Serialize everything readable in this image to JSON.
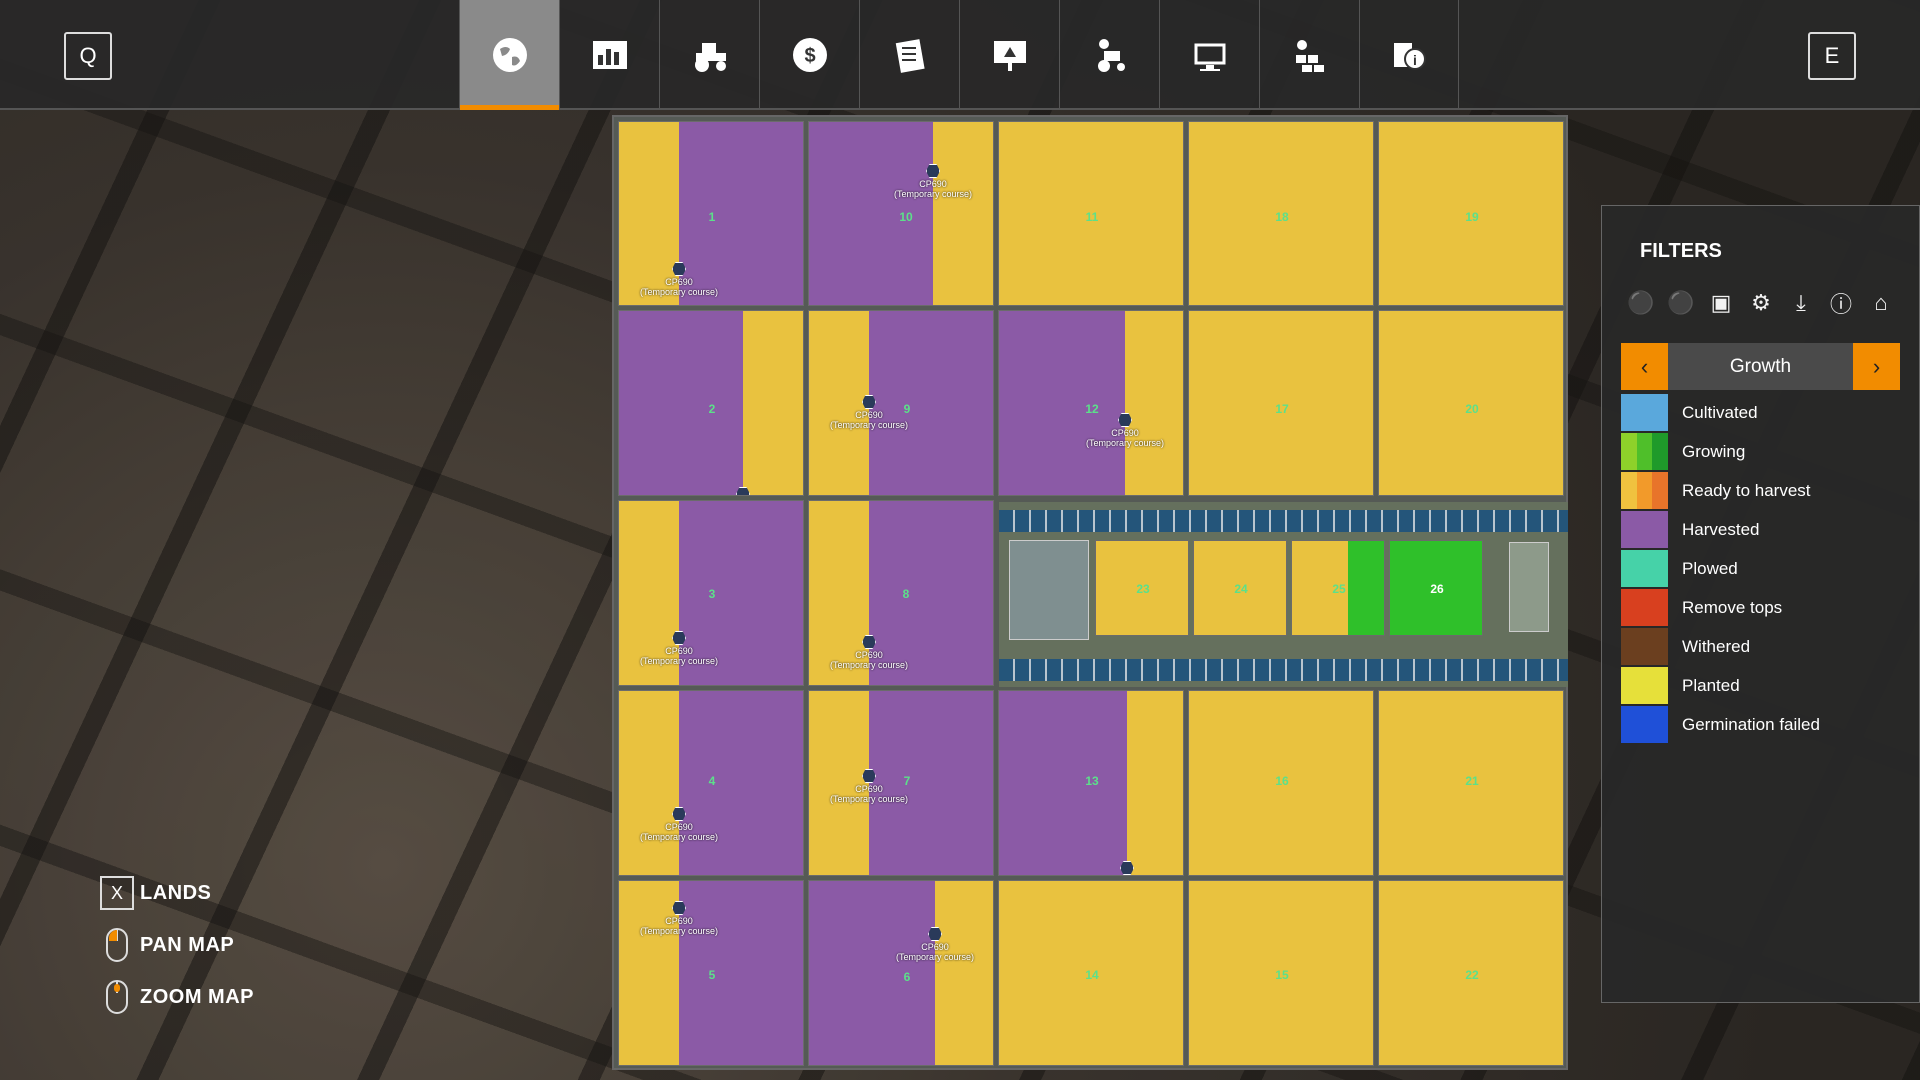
{
  "topbar": {
    "left_key": "Q",
    "right_key": "E",
    "tabs": [
      {
        "icon": "globe-icon",
        "active": true
      },
      {
        "icon": "statistics-icon",
        "active": false
      },
      {
        "icon": "tractor-icon",
        "active": false
      },
      {
        "icon": "finances-icon",
        "active": false
      },
      {
        "icon": "contracts-icon",
        "active": false
      },
      {
        "icon": "animals-icon",
        "active": false
      },
      {
        "icon": "workers-icon",
        "active": false
      },
      {
        "icon": "settings-icon",
        "active": false
      },
      {
        "icon": "production-icon",
        "active": false
      },
      {
        "icon": "help-icon",
        "active": false
      }
    ]
  },
  "map": {
    "fields": [
      {
        "num": "1"
      },
      {
        "num": "10"
      },
      {
        "num": "11"
      },
      {
        "num": "18"
      },
      {
        "num": "19"
      },
      {
        "num": "2"
      },
      {
        "num": "9"
      },
      {
        "num": "12"
      },
      {
        "num": "17"
      },
      {
        "num": "20"
      },
      {
        "num": "3"
      },
      {
        "num": "8"
      },
      {
        "num": "4"
      },
      {
        "num": "7"
      },
      {
        "num": "13"
      },
      {
        "num": "16"
      },
      {
        "num": "21"
      },
      {
        "num": "5"
      },
      {
        "num": "6"
      },
      {
        "num": "14"
      },
      {
        "num": "15"
      },
      {
        "num": "22"
      },
      {
        "num": "23"
      },
      {
        "num": "24"
      },
      {
        "num": "25"
      },
      {
        "num": "26"
      }
    ],
    "marker_label": "CP690",
    "marker_sub": "(Temporary course)"
  },
  "hints": {
    "lands_key": "X",
    "lands": "LANDS",
    "pan": "PAN MAP",
    "zoom": "ZOOM MAP"
  },
  "filters": {
    "title": "FILTERS",
    "selector": "Growth",
    "legend": [
      {
        "label": "Cultivated",
        "colors": [
          "#5aa8dc"
        ]
      },
      {
        "label": "Growing",
        "colors": [
          "#8ed12a",
          "#4fbf2a",
          "#1f9a2a"
        ]
      },
      {
        "label": "Ready to harvest",
        "colors": [
          "#f0c23f",
          "#f29a2a",
          "#e8742a"
        ]
      },
      {
        "label": "Harvested",
        "colors": [
          "#8b5aa6"
        ]
      },
      {
        "label": "Plowed",
        "colors": [
          "#46d2a8"
        ]
      },
      {
        "label": "Remove tops",
        "colors": [
          "#d8401f"
        ]
      },
      {
        "label": "Withered",
        "colors": [
          "#6b3f1f"
        ]
      },
      {
        "label": "Planted",
        "colors": [
          "#e6e03a"
        ]
      },
      {
        "label": "Germination failed",
        "colors": [
          "#1f50d8"
        ]
      }
    ]
  }
}
